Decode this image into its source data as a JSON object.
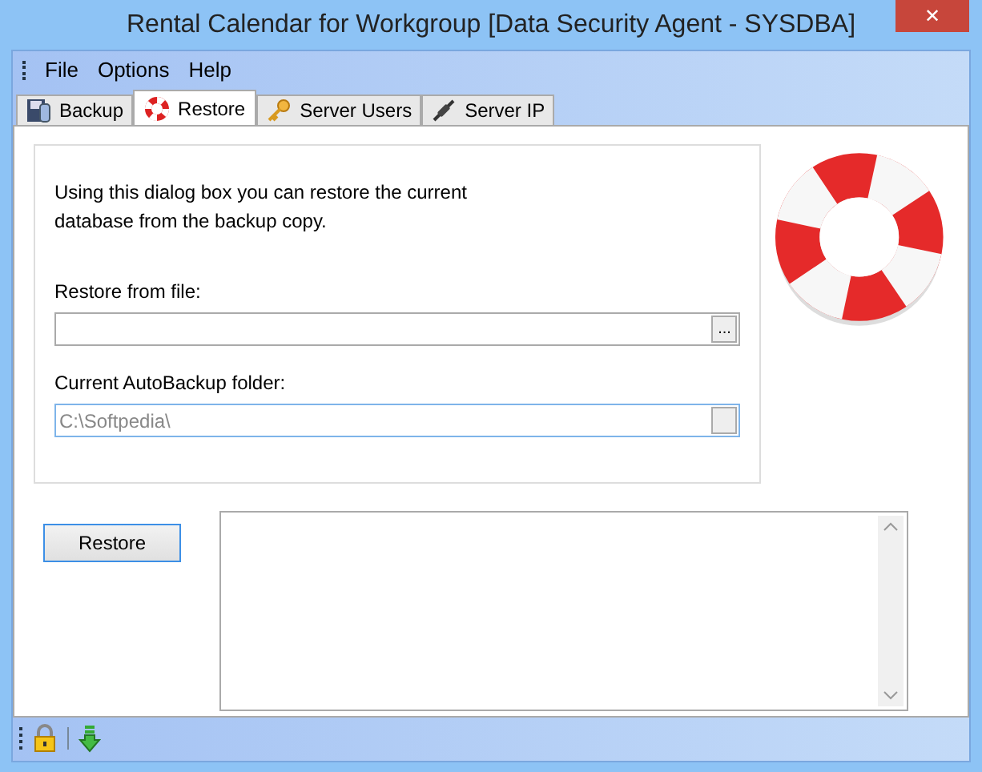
{
  "window": {
    "title": "Rental Calendar for Workgroup [Data Security Agent - SYSDBA]",
    "close": "✕"
  },
  "menu": [
    "File",
    "Options",
    "Help"
  ],
  "tabs": [
    {
      "label": "Backup",
      "selected": false
    },
    {
      "label": "Restore",
      "selected": true
    },
    {
      "label": "Server Users",
      "selected": false
    },
    {
      "label": "Server IP",
      "selected": false
    }
  ],
  "intro": "Using this dialog box you can restore the current database from the backup copy.",
  "restore_from_file": {
    "label": "Restore from file:",
    "browse": "..."
  },
  "autobackup_folder": {
    "label": "Current AutoBackup folder:",
    "value": "C:\\Softpedia\\",
    "disabled": true
  },
  "restore_button": "Restore"
}
